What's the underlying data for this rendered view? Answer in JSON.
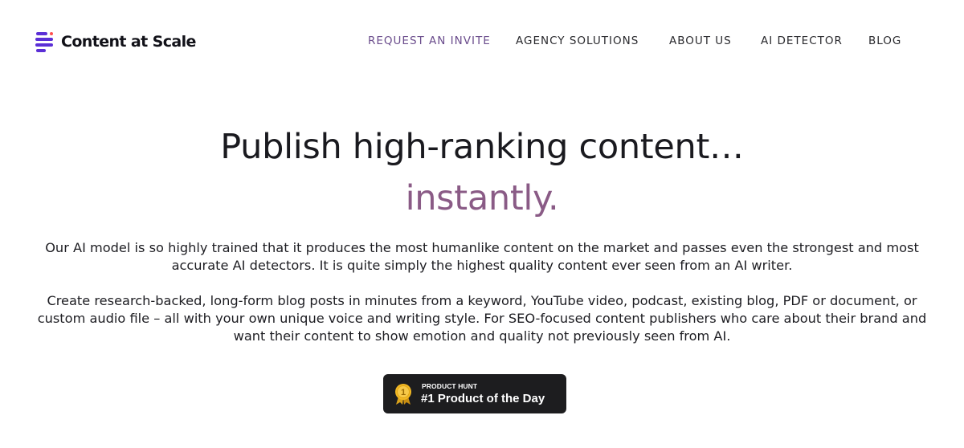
{
  "brand": {
    "name": "Content at Scale",
    "logo_icon": "stacked-bars-logo-icon",
    "logo_color": "#5b2fd6"
  },
  "nav": {
    "items": [
      {
        "label": "REQUEST AN INVITE",
        "color": "#6a4c8c"
      },
      {
        "label": "AGENCY SOLUTIONS"
      },
      {
        "label": "ABOUT US"
      },
      {
        "label": "AI DETECTOR"
      },
      {
        "label": "BLOG"
      }
    ]
  },
  "hero": {
    "title": "Publish high-ranking content…",
    "accent": "instantly.",
    "accent_color": "#8a5b86",
    "paragraph1": "Our AI model is so highly trained that it produces the most humanlike content on the market and passes even the strongest and most accurate AI detectors. It is quite simply the highest quality content ever seen from an AI writer.",
    "paragraph2": "Create research-backed, long-form blog posts in minutes from a keyword, YouTube video, podcast, existing blog, PDF or document, or custom audio file – all with your own unique voice and writing style. For SEO-focused content publishers who care about their brand and want their content to show emotion and quality not previously seen from AI."
  },
  "badge": {
    "kicker": "PRODUCT HUNT",
    "title": "#1 Product of the Day",
    "icon": "gold-medal-icon",
    "medal_number": "1",
    "background": "#1d1d1f"
  }
}
